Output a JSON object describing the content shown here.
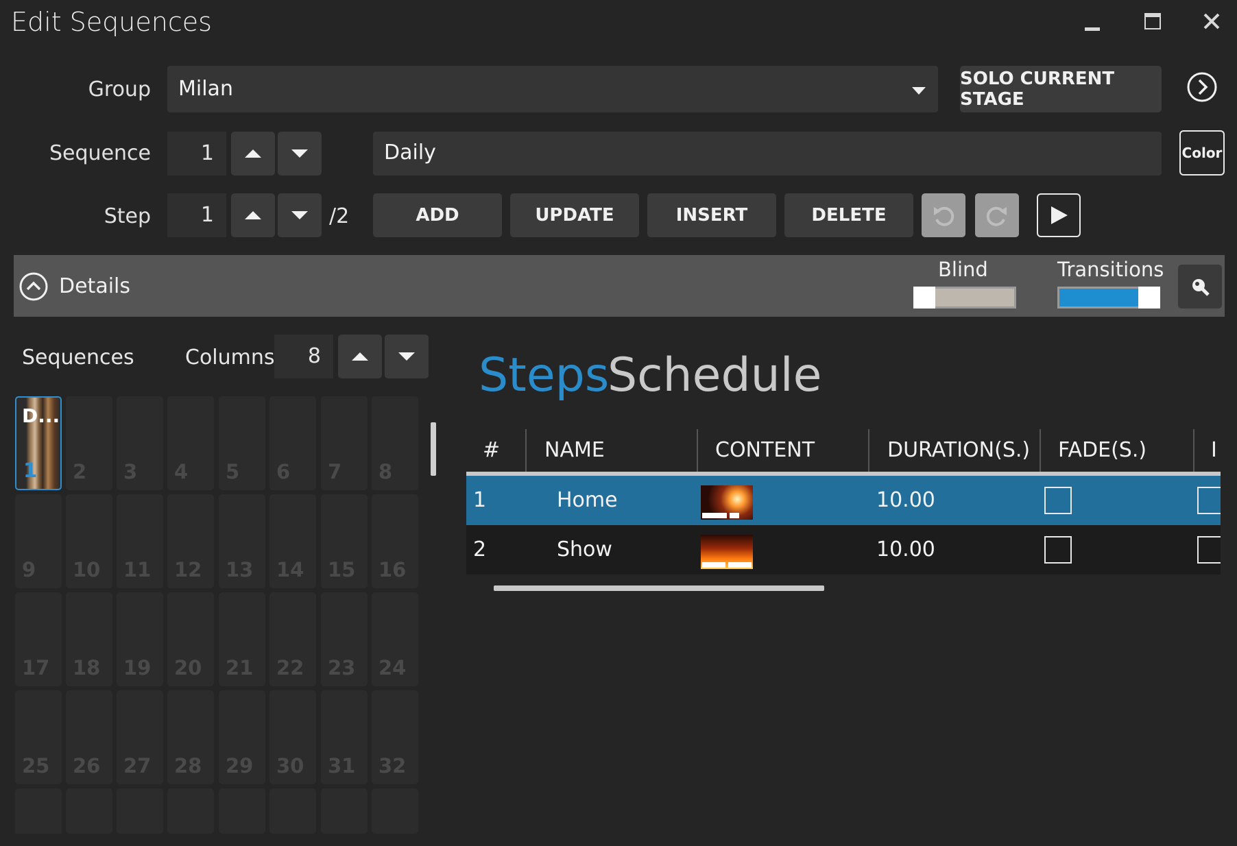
{
  "window": {
    "title": "Edit Sequences",
    "minimize_icon": "minimize-icon",
    "maximize_icon": "maximize-icon",
    "close_icon": "close-icon"
  },
  "group": {
    "label": "Group",
    "value": "Milan",
    "solo_label": "SOLO CURRENT STAGE"
  },
  "sequence": {
    "label": "Sequence",
    "number": "1",
    "name": "Daily",
    "color_label": "Color"
  },
  "step": {
    "label": "Step",
    "number": "1",
    "total": "/2",
    "add_label": "ADD",
    "update_label": "UPDATE",
    "insert_label": "INSERT",
    "delete_label": "DELETE"
  },
  "details": {
    "label": "Details",
    "blind_label": "Blind",
    "transitions_label": "Transitions",
    "blind_on": false,
    "transitions_on": true,
    "accent": "#1e8ed0"
  },
  "sequences_panel": {
    "label": "Sequences",
    "columns_label": "Columns",
    "columns_value": "8",
    "selected": {
      "abbrev": "D...",
      "number": "1"
    },
    "cells": [
      "2",
      "3",
      "4",
      "5",
      "6",
      "7",
      "8",
      "9",
      "10",
      "11",
      "12",
      "13",
      "14",
      "15",
      "16",
      "17",
      "18",
      "19",
      "20",
      "21",
      "22",
      "23",
      "24",
      "25",
      "26",
      "27",
      "28",
      "29",
      "30",
      "31",
      "32"
    ]
  },
  "tabs": {
    "steps": "Steps",
    "schedule": "Schedule"
  },
  "table": {
    "headers": {
      "num": "#",
      "name": "NAME",
      "content": "CONTENT",
      "duration": "DURATION(S.)",
      "fade": "FADE(S.)",
      "extra": "I"
    },
    "rows": [
      {
        "num": "1",
        "name": "Home",
        "duration": "10.00"
      },
      {
        "num": "2",
        "name": "Show",
        "duration": "10.00"
      }
    ]
  },
  "colors": {
    "selected_row": "#236f9c",
    "background": "#252525"
  }
}
